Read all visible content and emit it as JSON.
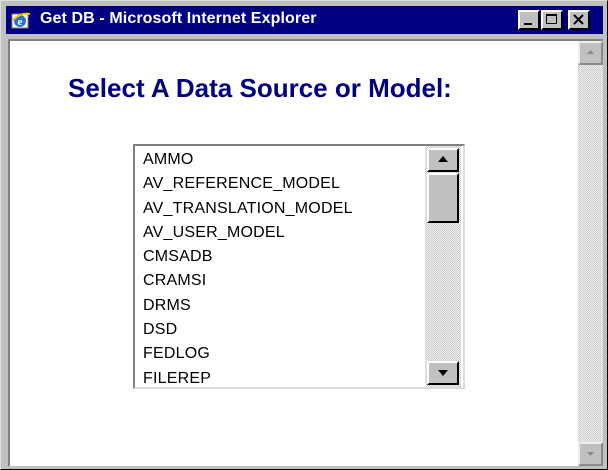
{
  "window": {
    "title": "Get DB - Microsoft Internet Explorer",
    "title_bar_color": "#000080",
    "icons": {
      "app": "internet-explorer-icon",
      "minimize": "minimize-icon",
      "maximize": "maximize-icon",
      "close": "close-icon"
    }
  },
  "page": {
    "heading": "Select A Data Source or Model:",
    "heading_color": "#000080"
  },
  "data_source_list": {
    "items": [
      "AMMO",
      "AV_REFERENCE_MODEL",
      "AV_TRANSLATION_MODEL",
      "AV_USER_MODEL",
      "CMSADB",
      "CRAMSI",
      "DRMS",
      "DSD",
      "FEDLOG",
      "FILEREP"
    ]
  }
}
